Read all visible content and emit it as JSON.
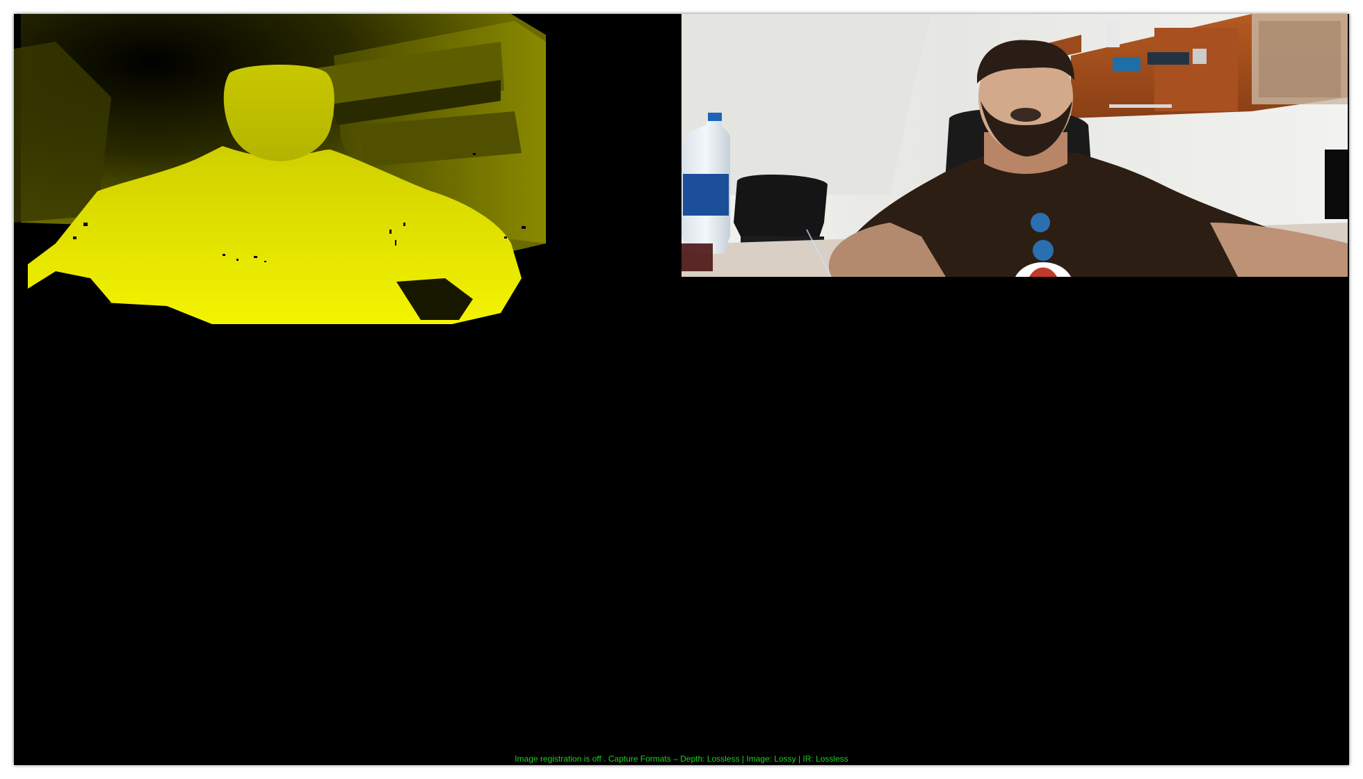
{
  "status": {
    "text": "Image registration is off . Capture Formats – Depth: Lossless | Image: Lossy | IR: Lossless",
    "color": "#1ed21e"
  },
  "viewers": {
    "depth": {
      "kind": "depth-stream",
      "colormap_color": "#e8e800"
    },
    "color": {
      "kind": "color-stream"
    }
  },
  "window": {
    "background": "#000000"
  }
}
